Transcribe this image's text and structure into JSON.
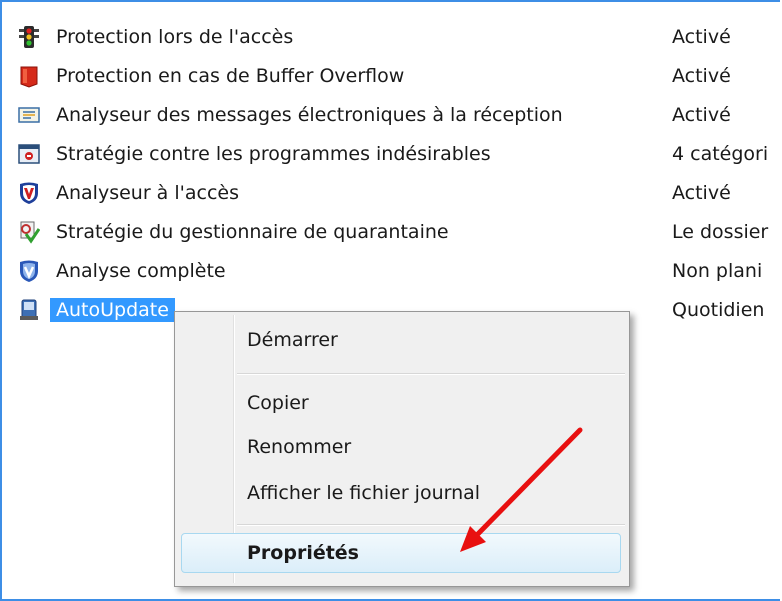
{
  "items": [
    {
      "name": "Protection lors de l'accès",
      "status": "Activé",
      "icon": "traffic-light-icon"
    },
    {
      "name": "Protection en cas de Buffer Overflow",
      "status": "Activé",
      "icon": "red-shield-icon"
    },
    {
      "name": "Analyseur des messages électroniques à la réception",
      "status": "Activé",
      "icon": "mail-scanner-icon"
    },
    {
      "name": "Stratégie contre les programmes indésirables",
      "status": "4 catégori",
      "icon": "unwanted-programs-icon"
    },
    {
      "name": "Analyseur à l'accès",
      "status": "Activé",
      "icon": "mcafee-shield-icon"
    },
    {
      "name": "Stratégie du gestionnaire de quarantaine",
      "status": "Le dossier",
      "icon": "quarantine-icon"
    },
    {
      "name": "Analyse complète",
      "status": "Non plani",
      "icon": "blue-shield-icon"
    },
    {
      "name": "AutoUpdate",
      "status": "Quotidien",
      "icon": "autoupdate-icon"
    }
  ],
  "context_menu": {
    "start": "Démarrer",
    "copy": "Copier",
    "rename": "Renommer",
    "view_log": "Afficher le fichier journal",
    "properties": "Propriétés"
  },
  "colors": {
    "selection": "#3399ff",
    "frame_border": "#3d8ee6",
    "arrow": "#e81010"
  }
}
